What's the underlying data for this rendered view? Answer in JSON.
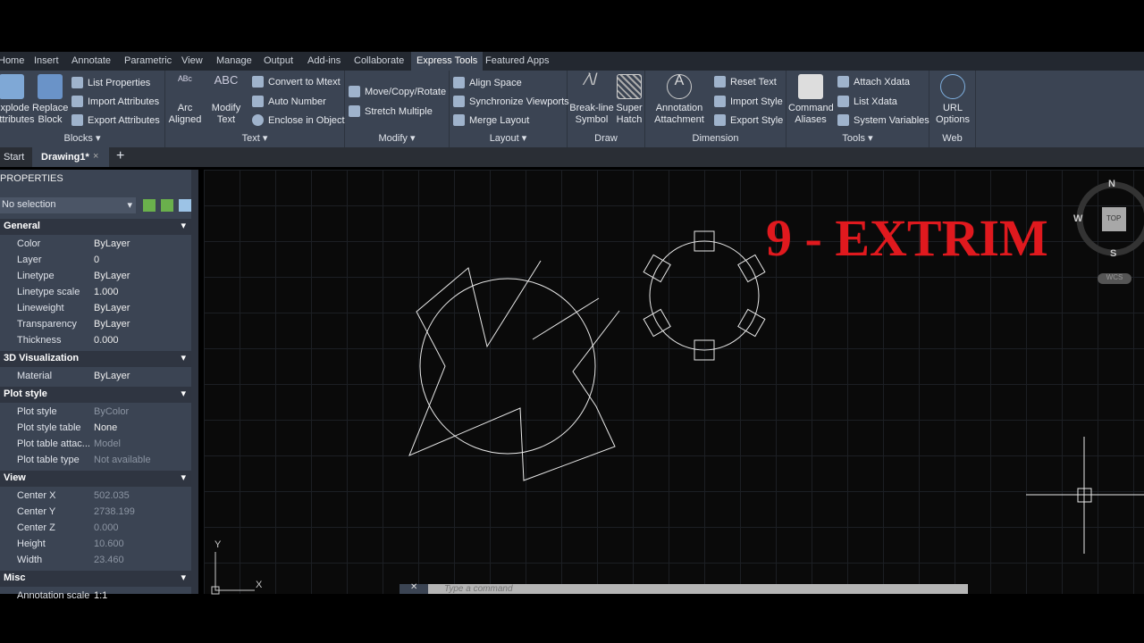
{
  "ribbon_tabs": [
    "Home",
    "Insert",
    "Annotate",
    "Parametric",
    "View",
    "Manage",
    "Output",
    "Add-ins",
    "Collaborate",
    "Express Tools",
    "Featured Apps"
  ],
  "active_tab": "Express Tools",
  "panels": {
    "blocks": {
      "title": "Blocks",
      "explode": "Explode Attributes",
      "replace": "Replace Block",
      "list_props": "List Properties",
      "import_attr": "Import Attributes",
      "export_attr": "Export Attributes"
    },
    "text": {
      "title": "Text",
      "arc": "Arc Aligned",
      "modify": "Modify Text",
      "convert": "Convert to Mtext",
      "autonum": "Auto Number",
      "enclose": "Enclose in Object"
    },
    "modify": {
      "title": "Modify",
      "mcr": "Move/Copy/Rotate",
      "stretch": "Stretch Multiple"
    },
    "layout": {
      "title": "Layout",
      "align": "Align Space",
      "sync": "Synchronize Viewports",
      "merge": "Merge Layout"
    },
    "draw": {
      "title": "Draw",
      "breakline": "Break-line Symbol",
      "superhatch": "Super Hatch"
    },
    "dimension": {
      "title": "Dimension",
      "annot": "Annotation Attachment",
      "reset": "Reset Text",
      "import": "Import Style",
      "export": "Export Style"
    },
    "tools": {
      "title": "Tools",
      "aliases": "Command Aliases",
      "attach": "Attach Xdata",
      "list": "List Xdata",
      "sysvar": "System Variables"
    },
    "web": {
      "title": "Web",
      "url": "URL Options"
    }
  },
  "doc_tabs": {
    "start": "Start",
    "drawing": "Drawing1*",
    "close": "×",
    "add": "+"
  },
  "properties": {
    "title": "PROPERTIES",
    "selection": "No selection",
    "sections": [
      "General",
      "3D Visualization",
      "Plot style",
      "View",
      "Misc"
    ],
    "general": [
      [
        "Color",
        "ByLayer"
      ],
      [
        "Layer",
        "0"
      ],
      [
        "Linetype",
        "ByLayer"
      ],
      [
        "Linetype scale",
        "1.000"
      ],
      [
        "Lineweight",
        "ByLayer"
      ],
      [
        "Transparency",
        "ByLayer"
      ],
      [
        "Thickness",
        "0.000"
      ]
    ],
    "vis": [
      [
        "Material",
        "ByLayer"
      ]
    ],
    "plot": [
      [
        "Plot style",
        "ByColor"
      ],
      [
        "Plot style table",
        "None"
      ],
      [
        "Plot table attac...",
        "Model"
      ],
      [
        "Plot table type",
        "Not available"
      ]
    ],
    "view": [
      [
        "Center X",
        "502.035"
      ],
      [
        "Center Y",
        "2738.199"
      ],
      [
        "Center Z",
        "0.000"
      ],
      [
        "Height",
        "10.600"
      ],
      [
        "Width",
        "23.460"
      ]
    ],
    "misc": [
      [
        "Annotation scale",
        "1:1"
      ]
    ]
  },
  "canvas": {
    "title_text": "9 - EXTRIM",
    "title_color": "#e0191e",
    "viewcube": {
      "n": "N",
      "s": "S",
      "w": "W",
      "top": "TOP",
      "wcs": "WCS"
    },
    "ucs_x": "X",
    "ucs_y": "Y"
  },
  "command": {
    "placeholder": "Type a command"
  }
}
